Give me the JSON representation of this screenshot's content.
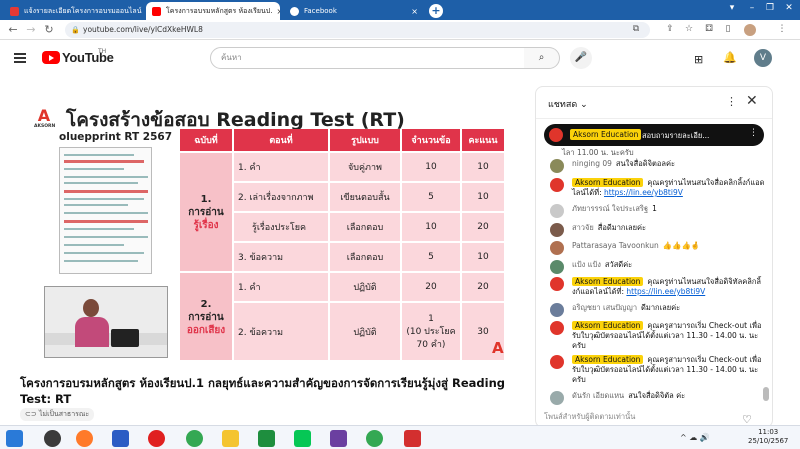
{
  "browser": {
    "tabs": [
      {
        "label": "แจ้งรายละเอียดโครงการอบรมออนไลน์ 2",
        "active": false
      },
      {
        "label": "โครงการอบรมหลักสูตร ห้องเรียนป.",
        "active": true
      },
      {
        "label": "Facebook",
        "active": false
      }
    ],
    "url": "youtube.com/live/ylCdXkeHWL8",
    "window_controls": [
      "▾",
      "–",
      "❐",
      "✕"
    ]
  },
  "youtube": {
    "logo_text": "YouTube",
    "logo_suffix": "TH",
    "search_placeholder": "ค้นหา",
    "avatar_letter": "V"
  },
  "slide": {
    "title": "โครงสร้างข้อสอบ Reading Test (RT)",
    "brand": "AKSORN",
    "blueprint_label": "oluepprint RT 2567",
    "headers": [
      "ฉบับที่",
      "ตอนที่",
      "รูปแบบ",
      "จำนวนข้อ",
      "คะแนน"
    ],
    "sections": [
      {
        "num": "1.",
        "line1": "การอ่าน",
        "line2": "รู้เรื่อง",
        "rows": [
          {
            "part": "1. คำ",
            "format": "จับคู่ภาพ",
            "count": "10",
            "score": "10"
          },
          {
            "part": "2. เล่าเรื่องจากภาพ",
            "format": "เขียนตอบสั้น",
            "count": "5",
            "score": "10"
          },
          {
            "part": "รู้เรื่องประโยค",
            "format": "เลือกตอบ",
            "count": "10",
            "score": "20"
          },
          {
            "part": "3. ข้อความ",
            "format": "เลือกตอบ",
            "count": "5",
            "score": "10"
          }
        ]
      },
      {
        "num": "2.",
        "line1": "การอ่าน",
        "line2": "ออกเสียง",
        "rows": [
          {
            "part": "1. คำ",
            "format": "ปฏิบัติ",
            "count": "20",
            "score": "20"
          },
          {
            "part": "2. ข้อความ",
            "format": "ปฏิบัติ",
            "count": "1\n(10 ประโยค\n70 คำ)",
            "score": "30"
          }
        ]
      }
    ]
  },
  "video": {
    "title": "โครงการอบรมหลักสูตร ห้องเรียนป.1 กลยุทธ์และความสำคัญของการจัดการเรียนรู้มุ่งสู่ Reading Test: RT",
    "visibility": "ไม่เป็นสาธารณะ"
  },
  "chat": {
    "title": "แชทสด",
    "pinned": {
      "author": "Aksorn Education",
      "text": "สอบถามรายละเอีย..."
    },
    "pinned_tail": "ไลา 11.00 น. นะครับ",
    "messages": [
      {
        "author": "ninging 09",
        "owner": false,
        "text": "สนใจสื่อดิจิตอลค่ะ",
        "link": "",
        "avatar_color": "#8a8a5a"
      },
      {
        "author": "Aksorn Education",
        "owner": true,
        "text": "คุณครูท่านไหนสนใจสื่อคลิกลิ้งก์แอดไลน์ได้ที่: ",
        "link": "https://lin.ee/yb8ti9V",
        "avatar_color": "#e0352b"
      },
      {
        "author": "ภัทยารรรณ์ ใจประเสริฐ",
        "owner": false,
        "text": "1",
        "link": "",
        "avatar_color": "#c9c9c9"
      },
      {
        "author": "สาวจัย",
        "owner": false,
        "text": "สื่อดีมากเลยค่ะ",
        "link": "",
        "avatar_color": "#7b5b4b"
      },
      {
        "author": "Pattarasaya Tavoonkun",
        "owner": false,
        "text": "👍👍👍🤞",
        "link": "",
        "avatar_color": "#b07050"
      },
      {
        "author": "แป้ง แป้ง",
        "owner": false,
        "text": "สวัสดีค่ะ",
        "link": "",
        "avatar_color": "#5a8a6a"
      },
      {
        "author": "Aksorn Education",
        "owner": true,
        "text": "คุณครูท่านไหนสนใจสื่อดิจิทัลคลิกลิ้งก์แอดไลน์ได้ที่: ",
        "link": "https://lin.ee/yb8ti9V",
        "avatar_color": "#e0352b"
      },
      {
        "author": "อริญชยา เสนปัญญา",
        "owner": false,
        "text": "ดีมากเลยค่ะ",
        "link": "",
        "avatar_color": "#6b7d9b"
      },
      {
        "author": "Aksorn Education",
        "owner": true,
        "text": "คุณครูสามารถเริ่ม Check-out เพื่อรับใบวุฒิบัตรออนไลน์ได้ตั้งแต่เวลา 11.30 - 14.00 น. นะครับ",
        "link": "",
        "avatar_color": "#e0352b"
      },
      {
        "author": "Aksorn Education",
        "owner": true,
        "text": "คุณครูสามารถเริ่ม Check-out เพื่อรับใบวุฒิบัตรออนไลน์ได้ตั้งแต่เวลา 11.30 - 14.00 น. นะครับ",
        "link": "",
        "avatar_color": "#e0352b"
      },
      {
        "author": "ดันรัก เอียดแหน",
        "owner": false,
        "text": "สนใจสื่อดิจิตัล ค่ะ",
        "link": "",
        "avatar_color": "#9aa"
      }
    ],
    "input_placeholder": "โพนส์สำหรับผู้ติดตามเท่านั้น"
  },
  "taskbar": {
    "time": "11:03",
    "date": "25/10/2567",
    "tray": "^ ☁ 🔊"
  },
  "colors": {
    "tab_strip": "#1e5fa8",
    "slide_header": "#e0344a",
    "slide_cell": "#fbd7dc",
    "owner_badge": "#fbd20a"
  }
}
